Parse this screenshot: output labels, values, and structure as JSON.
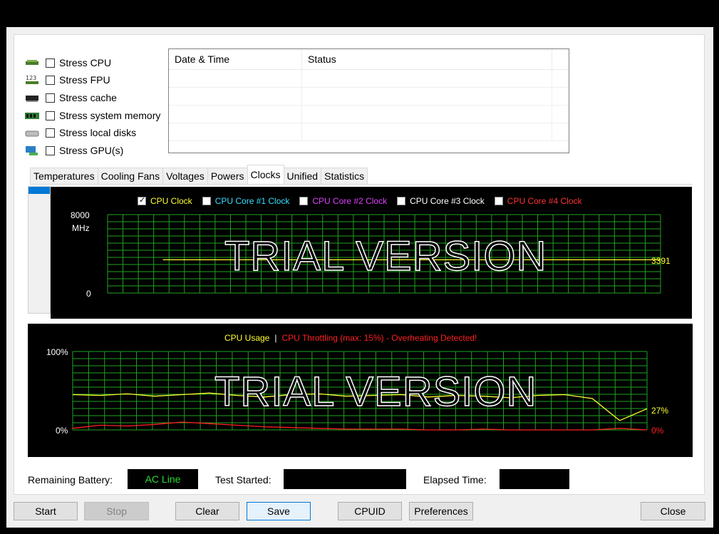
{
  "stress_options": [
    {
      "label": "Stress CPU",
      "icon": "cpu-chip-icon",
      "checked": false
    },
    {
      "label": "Stress FPU",
      "icon": "fpu-123-icon",
      "checked": false
    },
    {
      "label": "Stress cache",
      "icon": "cache-chip-icon",
      "checked": false
    },
    {
      "label": "Stress system memory",
      "icon": "memory-module-icon",
      "checked": false
    },
    {
      "label": "Stress local disks",
      "icon": "disk-drive-icon",
      "checked": false
    },
    {
      "label": "Stress GPU(s)",
      "icon": "gpu-icon",
      "checked": false
    }
  ],
  "log_table": {
    "columns": [
      "Date & Time",
      "Status"
    ],
    "rows": []
  },
  "tabs": [
    "Temperatures",
    "Cooling Fans",
    "Voltages",
    "Powers",
    "Clocks",
    "Unified",
    "Statistics"
  ],
  "active_tab": "Clocks",
  "clock_graph": {
    "legend": [
      {
        "label": "CPU Clock",
        "color": "#ffff33",
        "checked": true
      },
      {
        "label": "CPU Core #1 Clock",
        "color": "#33e0ff",
        "checked": false
      },
      {
        "label": "CPU Core #2 Clock",
        "color": "#e040ff",
        "checked": false
      },
      {
        "label": "CPU Core #3 Clock",
        "color": "#ffffff",
        "checked": false
      },
      {
        "label": "CPU Core #4 Clock",
        "color": "#ff3333",
        "checked": false
      }
    ],
    "y_max_label": "8000",
    "y_unit_label": "MHz",
    "y_min_label": "0",
    "current_value": "3391",
    "watermark": "TRIAL VERSION",
    "grid_color": "#1fa31f"
  },
  "usage_graph": {
    "legend_usage": "CPU Usage",
    "legend_separator": "|",
    "legend_throttling": "CPU Throttling (max: 15%) - Overheating Detected!",
    "y_max_label": "100%",
    "y_min_label": "0%",
    "current_usage": "27%",
    "current_throttling": "0%",
    "watermark": "TRIAL VERSION",
    "usage_color": "#ffff33",
    "throttling_color": "#ff2020"
  },
  "info": {
    "battery_label": "Remaining Battery:",
    "battery_value": "AC Line",
    "started_label": "Test Started:",
    "started_value": "",
    "elapsed_label": "Elapsed Time:",
    "elapsed_value": ""
  },
  "buttons": {
    "start": "Start",
    "stop": "Stop",
    "clear": "Clear",
    "save": "Save",
    "cpuid": "CPUID",
    "preferences": "Preferences",
    "close": "Close"
  },
  "chart_data": [
    {
      "type": "line",
      "title": "",
      "ylabel": "MHz",
      "ylim": [
        0,
        8000
      ],
      "series": [
        {
          "name": "CPU Clock",
          "latest": 3391,
          "values": [
            3391,
            3391,
            3391,
            3391,
            3391,
            3391,
            3391,
            3391,
            3391,
            3391
          ]
        }
      ],
      "grid": true
    },
    {
      "type": "line",
      "title": "",
      "ylim": [
        0,
        100
      ],
      "series": [
        {
          "name": "CPU Usage",
          "latest": 27,
          "values": [
            45,
            44,
            46,
            43,
            45,
            47,
            44,
            42,
            45,
            46,
            43,
            44,
            45,
            42,
            44,
            43,
            41,
            44,
            45,
            40,
            12,
            27
          ]
        },
        {
          "name": "CPU Throttling",
          "latest": 0,
          "values": [
            2,
            6,
            5,
            7,
            10,
            8,
            6,
            4,
            3,
            2,
            1,
            1,
            1,
            0,
            0,
            1,
            0,
            0,
            0,
            0,
            2,
            0
          ]
        }
      ],
      "grid": true
    }
  ]
}
